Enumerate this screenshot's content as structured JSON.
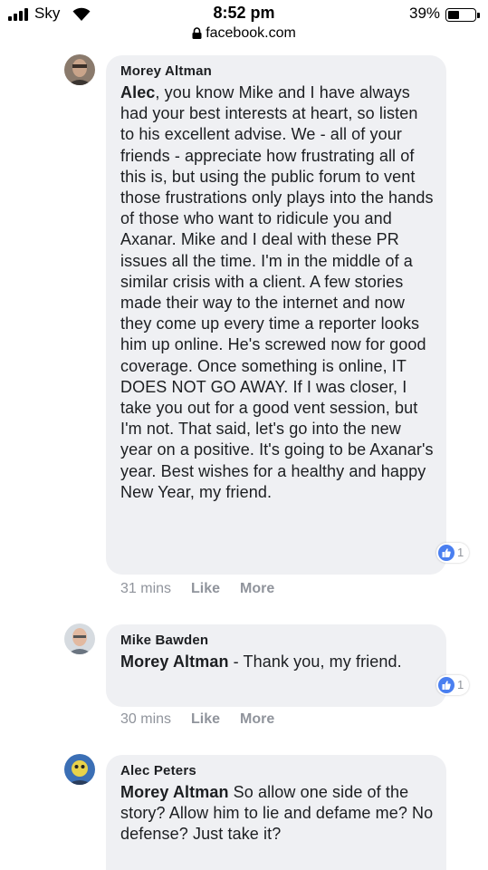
{
  "status_bar": {
    "carrier": "Sky",
    "time": "8:52 pm",
    "battery": "39%",
    "battery_level": 0.39
  },
  "browser": {
    "url": "facebook.com"
  },
  "comments": [
    {
      "author": "Morey Altman",
      "mention": "Alec",
      "text": ", you know Mike and I have always had your best interests at heart, so listen to his excellent advise. We - all of your friends - appreciate how frustrating all of this is, but using the public forum to vent those frustrations only plays into the hands of those who want to ridicule you and Axanar. Mike and I deal with these PR issues all the time. I'm in the middle of a similar crisis with a client. A few stories made their way to the internet and now they come up every time a reporter looks him up online. He's screwed now for good coverage. Once something is online, IT DOES NOT GO AWAY. If I was closer, I take you out for a good vent session, but I'm not. That said, let's go into the new year on a positive. It's going to be Axanar's year. Best wishes for a healthy and happy New Year, my friend.",
      "reactions": "1",
      "time": "31 mins",
      "like_label": "Like",
      "more_label": "More"
    },
    {
      "author": "Mike Bawden",
      "mention": "Morey Altman",
      "text": " - Thank you, my friend.",
      "reactions": "1",
      "time": "30 mins",
      "like_label": "Like",
      "more_label": "More"
    },
    {
      "author": "Alec Peters",
      "mention": "Morey Altman",
      "text": " So allow one side of the story? Allow him to lie and defame me? No defense? Just take it?"
    }
  ],
  "colors": {
    "bubble": "#eff0f3",
    "meta": "#90949c",
    "like_blue": "#4a7ff0"
  }
}
